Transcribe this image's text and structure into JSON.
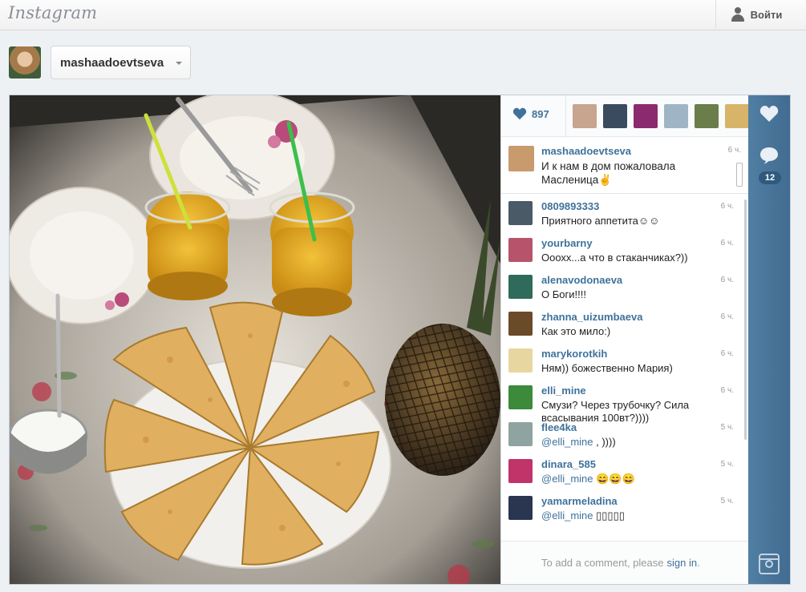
{
  "app": {
    "logo_text": "Instagram"
  },
  "topbar": {
    "login_label": "Войти",
    "login_icon": "person-icon"
  },
  "profile": {
    "username": "mashaadoevtseva"
  },
  "post": {
    "likes": "897",
    "caption": {
      "user": "mashaadoevtseva",
      "text": "И к нам в дом пожаловала Масленица✌",
      "time": "6 ч."
    },
    "comments": [
      {
        "user": "0809893333",
        "text": "Приятного аппетита☺☺",
        "mention": "",
        "time": "6 ч.",
        "avatar_color": "#4a5a66"
      },
      {
        "user": "yourbarny",
        "text": "Ооохх...а что в стаканчиках?))",
        "mention": "",
        "time": "6 ч.",
        "avatar_color": "#b7546b"
      },
      {
        "user": "alenavodonaeva",
        "text": "О Боги!!!!",
        "mention": "",
        "time": "6 ч.",
        "avatar_color": "#2f6a5a"
      },
      {
        "user": "zhanna_uizumbaeva",
        "text": "Как это мило:)",
        "mention": "",
        "time": "6 ч.",
        "avatar_color": "#6b4a2a"
      },
      {
        "user": "marykorotkih",
        "text": "Ням)) божественно Мария)",
        "mention": "",
        "time": "6 ч.",
        "avatar_color": "#e8d6a0"
      },
      {
        "user": "elli_mine",
        "text": "Смузи? Через трубочку? Сила всасывания 100вт?))))",
        "mention": "",
        "time": "6 ч.",
        "avatar_color": "#3c8a3a"
      },
      {
        "user": "flee4ka",
        "text": " , ))))",
        "mention": "@elli_mine",
        "time": "5 ч.",
        "avatar_color": "#8fa3a0"
      },
      {
        "user": "dinara_585",
        "text": " 😄😄😄",
        "mention": "@elli_mine",
        "time": "5 ч.",
        "avatar_color": "#c0346a"
      },
      {
        "user": "yamarmeladina",
        "text": " ▯▯▯▯▯",
        "mention": "@elli_mine",
        "time": "5 ч.",
        "avatar_color": "#2a3550"
      }
    ],
    "add_comment": {
      "prompt": "To add a comment, please",
      "link": "sign in",
      "suffix": "."
    },
    "comments_count": "12",
    "liker_colors": [
      "#c7a58f",
      "#3a4b5f",
      "#8c2a6e",
      "#9fb5c6",
      "#6b7d4a",
      "#d8b46a"
    ]
  },
  "rail": {
    "like_icon": "heart-icon",
    "comment_icon": "speech-bubble-icon",
    "camera_icon": "instagram-camera-icon"
  }
}
